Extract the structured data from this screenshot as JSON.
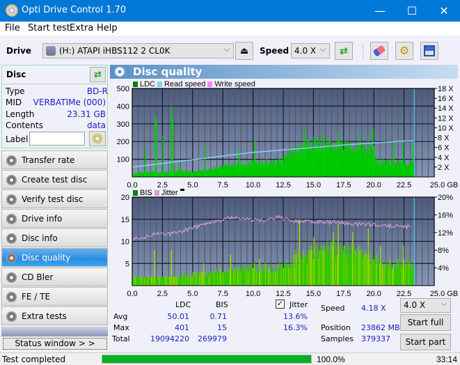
{
  "window": {
    "title": "Opti Drive Control 1.70",
    "minimize": "—",
    "maximize": "☐",
    "close": "✕"
  },
  "menu": [
    "File",
    "Start test",
    "Extra",
    "Help"
  ],
  "toolbar": {
    "drive_label": "Drive",
    "drive_value": "(H:)  ATAPI iHBS112  2 CL0K",
    "speed_label": "Speed",
    "speed_value": "4.0 X",
    "icons": [
      "eject-icon",
      "refresh-icon",
      "eraser-icon",
      "settings-icon",
      "save-icon"
    ]
  },
  "disc": {
    "title": "Disc",
    "type_label": "Type",
    "type": "BD-R",
    "mid_label": "MID",
    "mid": "VERBATIMe (000)",
    "length_label": "Length",
    "length": "23.31 GB",
    "contents_label": "Contents",
    "contents": "data",
    "label_label": "Label",
    "label_value": ""
  },
  "nav": [
    {
      "label": "Transfer rate"
    },
    {
      "label": "Create test disc"
    },
    {
      "label": "Verify test disc"
    },
    {
      "label": "Drive info"
    },
    {
      "label": "Disc info"
    },
    {
      "label": "Disc quality",
      "active": true
    },
    {
      "label": "CD Bler"
    },
    {
      "label": "FE / TE"
    },
    {
      "label": "Extra tests"
    }
  ],
  "status_window_btn": "Status window > >",
  "panel_title": "Disc quality",
  "chart_data": [
    {
      "type": "bar",
      "title": "LDC / Read speed",
      "legend": [
        "LDC",
        "Read speed",
        "Write speed"
      ],
      "legend_colors": [
        "#008000",
        "#87cefa",
        "#ff80ff"
      ],
      "xlabel": "GB",
      "xlim": [
        0,
        25
      ],
      "ylim": [
        0,
        500
      ],
      "y2lim": [
        0,
        18
      ],
      "xticks": [
        "0.0",
        "2.5",
        "5.0",
        "7.5",
        "10.0",
        "12.5",
        "15.0",
        "17.5",
        "20.0",
        "22.5",
        "25.0 GB"
      ],
      "yticks": [
        "500",
        "400",
        "300",
        "200",
        "100"
      ],
      "y2ticks": [
        "18 X",
        "16 X",
        "14 X",
        "12 X",
        "10 X",
        "8 X",
        "6 X",
        "4 X",
        "2 X"
      ],
      "ldc_profile": [
        [
          0,
          20
        ],
        [
          1,
          30
        ],
        [
          2,
          25
        ],
        [
          3,
          30
        ],
        [
          4,
          35
        ],
        [
          5,
          30
        ],
        [
          6,
          40
        ],
        [
          7,
          55
        ],
        [
          8,
          75
        ],
        [
          9,
          80
        ],
        [
          10,
          85
        ],
        [
          11,
          85
        ],
        [
          12,
          90
        ],
        [
          12.5,
          100
        ],
        [
          13,
          140
        ],
        [
          14,
          170
        ],
        [
          15,
          190
        ],
        [
          16,
          195
        ],
        [
          17,
          185
        ],
        [
          18,
          170
        ],
        [
          19,
          165
        ],
        [
          20,
          160
        ],
        [
          20.1,
          95
        ],
        [
          21,
          90
        ],
        [
          22,
          85
        ],
        [
          23,
          75
        ],
        [
          23.31,
          80
        ]
      ],
      "ldc_spikes": [
        [
          1.05,
          160
        ],
        [
          1.85,
          350
        ],
        [
          1.95,
          330
        ],
        [
          2.5,
          235
        ],
        [
          3.2,
          400
        ],
        [
          3.3,
          330
        ],
        [
          3.8,
          90
        ],
        [
          6.0,
          180
        ],
        [
          8.8,
          160
        ],
        [
          10.1,
          205
        ],
        [
          12.4,
          120
        ],
        [
          14.2,
          275
        ],
        [
          15.0,
          230
        ],
        [
          15.8,
          250
        ],
        [
          17.0,
          255
        ],
        [
          18.8,
          250
        ],
        [
          19.5,
          240
        ],
        [
          19.9,
          275
        ],
        [
          21.6,
          215
        ],
        [
          22.4,
          200
        ],
        [
          23.2,
          195
        ]
      ],
      "read_speed": [
        [
          0,
          2.0
        ],
        [
          1,
          2.3
        ],
        [
          2,
          2.6
        ],
        [
          3,
          2.9
        ],
        [
          4,
          3.2
        ],
        [
          5,
          3.5
        ],
        [
          6,
          3.8
        ],
        [
          7,
          4.1
        ],
        [
          8,
          4.4
        ],
        [
          9,
          4.7
        ],
        [
          10,
          5.0
        ],
        [
          12.5,
          5.5
        ],
        [
          15,
          6.0
        ],
        [
          17.5,
          6.5
        ],
        [
          20,
          6.9
        ],
        [
          22.5,
          7.3
        ],
        [
          23.31,
          7.3
        ]
      ]
    },
    {
      "type": "bar",
      "title": "BIS / Jitter",
      "legend": [
        "BIS",
        "Jitter"
      ],
      "legend_colors": [
        "#008000",
        "#d8a0d8"
      ],
      "xlabel": "GB",
      "xlim": [
        0,
        25
      ],
      "ylim": [
        0,
        20
      ],
      "y2lim": [
        0,
        20
      ],
      "xticks": [
        "0.0",
        "2.5",
        "5.0",
        "7.5",
        "10.0",
        "12.5",
        "15.0",
        "17.5",
        "20.0",
        "22.5",
        "25.0 GB"
      ],
      "yticks": [
        "20",
        "15",
        "10",
        "5"
      ],
      "y2ticks": [
        "20%",
        "16%",
        "12%",
        "8%",
        "4%"
      ],
      "bis_profile": [
        [
          0,
          2
        ],
        [
          2,
          2
        ],
        [
          5,
          2.5
        ],
        [
          7,
          3.5
        ],
        [
          10,
          4
        ],
        [
          12.5,
          4
        ],
        [
          13,
          6
        ],
        [
          14,
          7
        ],
        [
          15,
          8
        ],
        [
          16,
          8.5
        ],
        [
          17,
          8
        ],
        [
          18,
          8
        ],
        [
          19,
          7.5
        ],
        [
          20,
          6
        ],
        [
          21,
          5
        ],
        [
          22,
          5
        ],
        [
          23.31,
          5
        ]
      ],
      "bis_spikes": [
        [
          1.8,
          8
        ],
        [
          3.2,
          8
        ],
        [
          5.9,
          5
        ],
        [
          8.1,
          7
        ],
        [
          10.5,
          6
        ],
        [
          13.8,
          15
        ],
        [
          15.0,
          11
        ],
        [
          16.6,
          12
        ],
        [
          17.0,
          14
        ],
        [
          18.2,
          12
        ],
        [
          19.5,
          13
        ],
        [
          20.5,
          9
        ],
        [
          22.4,
          9
        ]
      ],
      "jitter": [
        [
          0,
          10.6
        ],
        [
          1,
          11
        ],
        [
          2,
          11.8
        ],
        [
          3,
          11.6
        ],
        [
          4,
          12.2
        ],
        [
          5,
          13
        ],
        [
          6,
          13.8
        ],
        [
          7,
          14.5
        ],
        [
          8,
          15.5
        ],
        [
          9,
          15.2
        ],
        [
          10,
          14.8
        ],
        [
          11,
          14.8
        ],
        [
          12,
          15.5
        ],
        [
          13,
          14.8
        ],
        [
          14,
          14.5
        ],
        [
          15,
          14.5
        ],
        [
          16,
          14.3
        ],
        [
          17,
          14.3
        ],
        [
          18,
          14
        ],
        [
          19,
          13.8
        ],
        [
          20,
          13.8
        ],
        [
          21,
          13.5
        ],
        [
          22,
          13.4
        ],
        [
          23,
          13.2
        ]
      ]
    }
  ],
  "stats": {
    "col_ldc": "LDC",
    "col_bis": "BIS",
    "jitter_label": "Jitter",
    "jitter_checked": true,
    "rows": [
      {
        "label": "Avg",
        "ldc": "50.01",
        "bis": "0.71",
        "jitter": "13.6%"
      },
      {
        "label": "Max",
        "ldc": "401",
        "bis": "15",
        "jitter": "16.3%"
      },
      {
        "label": "Total",
        "ldc": "19094220",
        "bis": "269979",
        "jitter": ""
      }
    ],
    "speed_label": "Speed",
    "speed": "4.18 X",
    "position_label": "Position",
    "position": "23862 MB",
    "samples_label": "Samples",
    "samples": "379337",
    "speed_select": "4.0 X",
    "start_full": "Start full",
    "start_part": "Start part"
  },
  "statusbar": {
    "text": "Test completed",
    "progress": 100.0,
    "progress_text": "100.0%",
    "time": "33:14"
  }
}
